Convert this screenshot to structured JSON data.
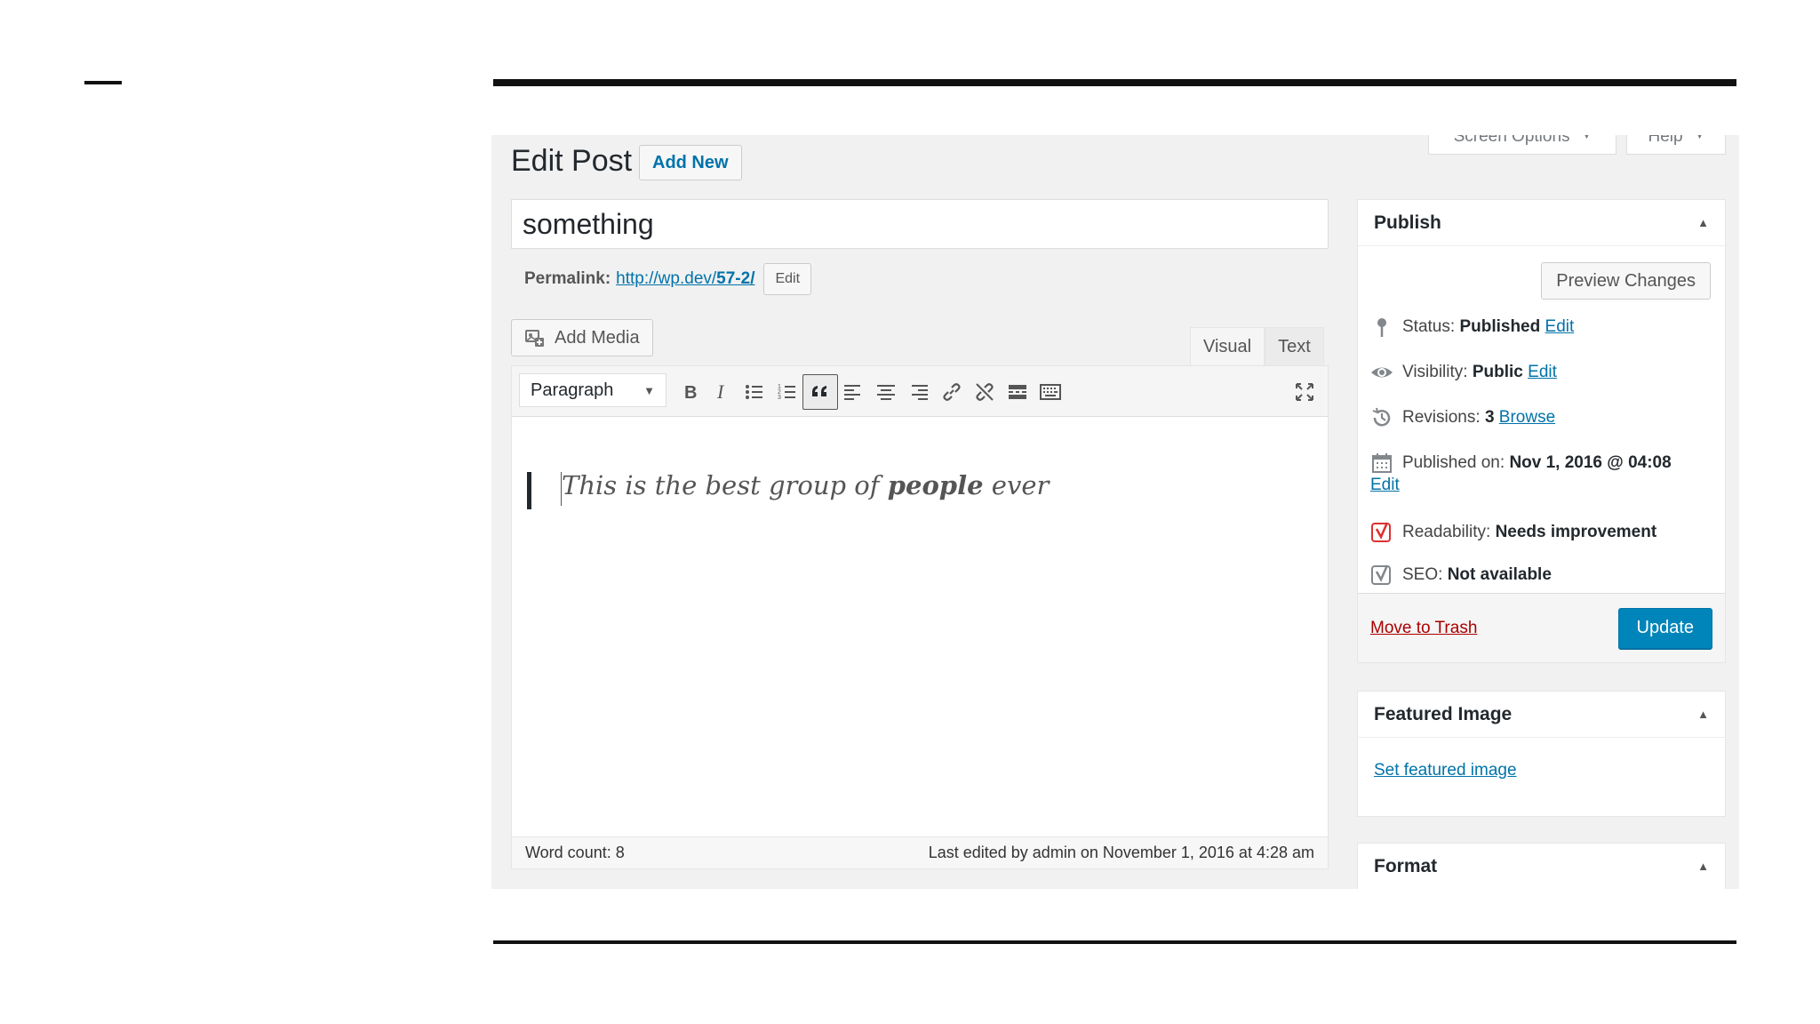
{
  "page": {
    "title": "Edit Post",
    "add_new_label": "Add New",
    "screen_options_label": "Screen Options",
    "help_label": "Help"
  },
  "post": {
    "title": "something",
    "permalink_label": "Permalink:",
    "permalink_url_base": "http://wp.dev/",
    "permalink_url_slug": "57-2/",
    "permalink_edit_label": "Edit"
  },
  "editor": {
    "add_media_label": "Add Media",
    "tabs": [
      {
        "label": "Visual",
        "active": true
      },
      {
        "label": "Text",
        "active": false
      }
    ],
    "format_select_value": "Paragraph",
    "content": {
      "quote_before": "This is the best group of ",
      "quote_bold": "people",
      "quote_after": " ever"
    },
    "word_count": "Word count: 8",
    "last_edited": "Last edited by admin on November 1, 2016 at 4:28 am"
  },
  "publish": {
    "heading": "Publish",
    "preview_label": "Preview Changes",
    "status_label": "Status:",
    "status_value": "Published",
    "visibility_label": "Visibility:",
    "visibility_value": "Public",
    "revisions_label": "Revisions:",
    "revisions_value": "3",
    "browse_label": "Browse",
    "published_on_label": "Published on:",
    "published_on_value": "Nov 1, 2016 @ 04:08",
    "edit_label": "Edit",
    "readability_label": "Readability:",
    "readability_value": "Needs improvement",
    "seo_label": "SEO:",
    "seo_value": "Not available",
    "trash_label": "Move to Trash",
    "update_label": "Update"
  },
  "featured_image": {
    "heading": "Featured Image",
    "set_label": "Set featured image"
  },
  "format_box": {
    "heading": "Format"
  },
  "colors": {
    "link": "#0073aa",
    "primary_button": "#0085ba",
    "trash": "#a00000",
    "readability_bad": "#dc3232"
  }
}
